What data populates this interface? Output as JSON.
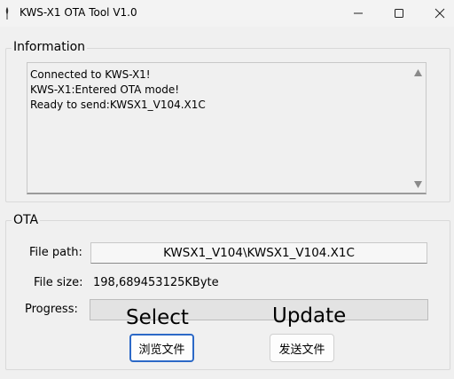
{
  "window": {
    "title": "KWS-X1 OTA Tool V1.0"
  },
  "information": {
    "legend": "Information",
    "log_lines": [
      "Connected to KWS-X1!",
      "KWS-X1:Entered OTA mode!",
      "Ready to send:KWSX1_V104.X1C"
    ]
  },
  "ota": {
    "legend": "OTA",
    "file_path_label": "File path:",
    "file_path_value": "KWSX1_V104\\KWSX1_V104.X1C",
    "file_size_label": "File size:",
    "file_size_value": "198,689453125KByte",
    "progress_label": "Progress:",
    "progress_value": 0,
    "select_caption": "Select",
    "update_caption": "Update",
    "browse_button": "浏览文件",
    "send_button": "发送文件"
  },
  "icons": {
    "app": "feather-icon",
    "minimize": "minimize-icon",
    "maximize": "maximize-icon",
    "close": "close-icon",
    "scroll_up": "triangle-up-icon",
    "scroll_down": "triangle-down-icon"
  },
  "colors": {
    "focus_border": "#2c69c7",
    "progress_fill": "#06b025"
  }
}
